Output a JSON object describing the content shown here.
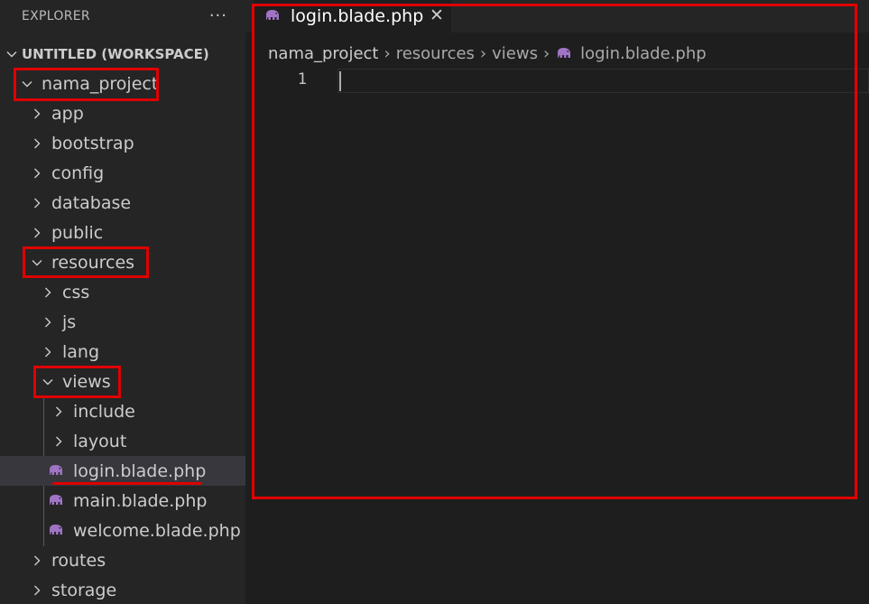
{
  "explorer": {
    "title": "EXPLORER",
    "more_icon": "ellipsis-icon",
    "workspace_label": "UNTITLED (WORKSPACE)",
    "tree": [
      {
        "label": "nama_project",
        "expanded": true,
        "type": "folder"
      },
      {
        "label": "app",
        "expanded": false,
        "type": "folder"
      },
      {
        "label": "bootstrap",
        "expanded": false,
        "type": "folder"
      },
      {
        "label": "config",
        "expanded": false,
        "type": "folder"
      },
      {
        "label": "database",
        "expanded": false,
        "type": "folder"
      },
      {
        "label": "public",
        "expanded": false,
        "type": "folder"
      },
      {
        "label": "resources",
        "expanded": true,
        "type": "folder"
      },
      {
        "label": "css",
        "expanded": false,
        "type": "folder"
      },
      {
        "label": "js",
        "expanded": false,
        "type": "folder"
      },
      {
        "label": "lang",
        "expanded": false,
        "type": "folder"
      },
      {
        "label": "views",
        "expanded": true,
        "type": "folder"
      },
      {
        "label": "include",
        "expanded": false,
        "type": "folder"
      },
      {
        "label": "layout",
        "expanded": false,
        "type": "folder"
      },
      {
        "label": "login.blade.php",
        "type": "file",
        "icon": "php-elephant-icon",
        "selected": true
      },
      {
        "label": "main.blade.php",
        "type": "file",
        "icon": "php-elephant-icon"
      },
      {
        "label": "welcome.blade.php",
        "type": "file",
        "icon": "php-elephant-icon"
      },
      {
        "label": "routes",
        "expanded": false,
        "type": "folder"
      },
      {
        "label": "storage",
        "expanded": false,
        "type": "folder"
      }
    ]
  },
  "editor": {
    "tab": {
      "label": "login.blade.php",
      "icon": "php-elephant-icon",
      "close_icon": "close-icon"
    },
    "breadcrumb": [
      "nama_project",
      "resources",
      "views",
      "login.blade.php"
    ],
    "line_numbers": [
      "1"
    ]
  },
  "colors": {
    "highlight": "#e00000",
    "php_icon": "#a074c4",
    "sidebar_bg": "#252526",
    "editor_bg": "#1e1e1e",
    "selected_row": "#37373d"
  }
}
